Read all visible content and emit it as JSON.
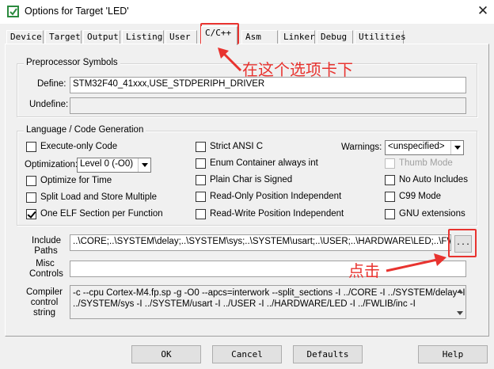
{
  "window": {
    "title": "Options for Target 'LED'",
    "close_glyph": "✕"
  },
  "tabs": [
    "Device",
    "Target",
    "Output",
    "Listing",
    "User",
    "C/C++",
    "Asm",
    "Linker",
    "Debug",
    "Utilities"
  ],
  "active_tab": "C/C++",
  "preprocessor": {
    "group_title": "Preprocessor Symbols",
    "define_label": "Define:",
    "define_value": "STM32F40_41xxx,USE_STDPERIPH_DRIVER",
    "undefine_label": "Undefine:",
    "undefine_value": ""
  },
  "codegen": {
    "group_title": "Language / Code Generation",
    "execute_only": {
      "label": "Execute-only Code",
      "checked": false
    },
    "optimization_label": "Optimization:",
    "optimization_value": "Level 0 (-O0)",
    "optimize_time": {
      "label": "Optimize for Time",
      "checked": false
    },
    "split_load": {
      "label": "Split Load and Store Multiple",
      "checked": false
    },
    "one_elf": {
      "label": "One ELF Section per Function",
      "checked": true
    },
    "strict_ansi": {
      "label": "Strict ANSI C",
      "checked": false
    },
    "enum_container": {
      "label": "Enum Container always int",
      "checked": false
    },
    "plain_char": {
      "label": "Plain Char is Signed",
      "checked": false
    },
    "ro_pos": {
      "label": "Read-Only Position Independent",
      "checked": false
    },
    "rw_pos": {
      "label": "Read-Write Position Independent",
      "checked": false
    },
    "warnings_label": "Warnings:",
    "warnings_value": "<unspecified>",
    "thumb_mode": {
      "label": "Thumb Mode",
      "checked": false,
      "disabled": true
    },
    "no_auto_includes": {
      "label": "No Auto Includes",
      "checked": false
    },
    "c99_mode": {
      "label": "C99 Mode",
      "checked": false
    },
    "gnu_ext": {
      "label": "GNU extensions",
      "checked": false
    }
  },
  "include_paths": {
    "label_line1": "Include",
    "label_line2": "Paths",
    "value": "..\\CORE;..\\SYSTEM\\delay;..\\SYSTEM\\sys;..\\SYSTEM\\usart;..\\USER;..\\HARDWARE\\LED;..\\FWLIB\\inc",
    "browse_label": "..."
  },
  "misc_controls": {
    "label_line1": "Misc",
    "label_line2": "Controls",
    "value": ""
  },
  "compiler_string": {
    "label_line1": "Compiler",
    "label_line2": "control",
    "label_line3": "string",
    "line1": "-c --cpu Cortex-M4.fp.sp -g -O0 --apcs=interwork --split_sections -I ../CORE -I ../SYSTEM/delay -I",
    "line2": "../SYSTEM/sys -I ../SYSTEM/usart -I ../USER -I ../HARDWARE/LED -I ../FWLIB/inc -I"
  },
  "buttons": {
    "ok": "OK",
    "cancel": "Cancel",
    "defaults": "Defaults",
    "help": "Help"
  },
  "annotations": {
    "tab_hint": "在这个选项卡下",
    "click_hint": "点击",
    "color": "#e8332f"
  }
}
